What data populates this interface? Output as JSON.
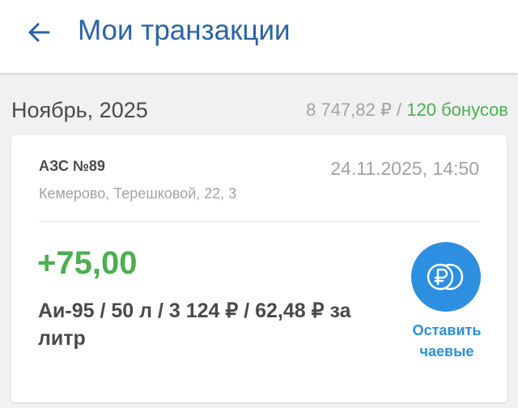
{
  "header": {
    "title": "Мои транзакции",
    "back_icon": "arrow-left-icon",
    "accent_color": "#2a63a8"
  },
  "month_group": {
    "label": "Ноябрь, 2025",
    "total_amount": "8 747,82 ₽",
    "separator": "/",
    "bonus_total": "120 бонусов"
  },
  "transaction": {
    "station": "АЗС №89",
    "datetime": "24.11.2025, 14:50",
    "address": "Кемерово, Терешковой, 22, 3",
    "bonus_change": "+75,00",
    "details": "Аи-95 / 50 л / 3 124 ₽ / 62,48 ₽ за литр",
    "tip_button_label": "Оставить чаевые",
    "tip_icon": "ruble-coins-icon",
    "tip_color": "#2d8fe0",
    "bonus_color": "#4caf50"
  }
}
